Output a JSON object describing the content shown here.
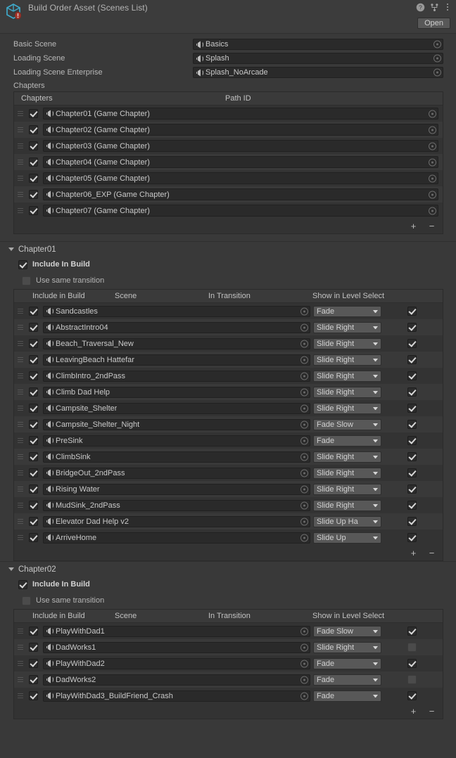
{
  "header": {
    "title": "Build Order Asset (Scenes List)",
    "asset_icon": "scriptable-object-cube-icon",
    "help_icon": "help-icon",
    "preset_icon": "preset-icon",
    "menu_icon": "kebab-menu-icon",
    "open_label": "Open"
  },
  "properties": [
    {
      "label": "Basic Scene",
      "value": "Basics"
    },
    {
      "label": "Loading Scene",
      "value": "Splash"
    },
    {
      "label": "Loading Scene Enterprise",
      "value": "Splash_NoArcade"
    }
  ],
  "chapters_section": {
    "label": "Chapters",
    "columns": {
      "chapters": "Chapters",
      "path_id": "Path ID"
    },
    "rows": [
      {
        "include": true,
        "name": "Chapter01 (Game Chapter)"
      },
      {
        "include": true,
        "name": "Chapter02 (Game Chapter)"
      },
      {
        "include": true,
        "name": "Chapter03 (Game Chapter)"
      },
      {
        "include": true,
        "name": "Chapter04 (Game Chapter)"
      },
      {
        "include": true,
        "name": "Chapter05 (Game Chapter)"
      },
      {
        "include": true,
        "name": "Chapter06_EXP (Game Chapter)"
      },
      {
        "include": true,
        "name": "Chapter07 (Game Chapter)"
      }
    ],
    "add_label": "+",
    "remove_label": "−"
  },
  "columns": {
    "include_in_build": "Include in Build",
    "scene": "Scene",
    "in_transition": "In Transition",
    "show_in_level_select": "Show in Level Select"
  },
  "chapter_sections": [
    {
      "name": "Chapter01",
      "include_in_build_label": "Include In Build",
      "include_in_build": true,
      "use_same_transition_label": "Use same transition",
      "use_same_transition": false,
      "scenes": [
        {
          "include": true,
          "scene": "Sandcastles",
          "transition": "Fade",
          "show": true
        },
        {
          "include": true,
          "scene": "AbstractIntro04",
          "transition": "Slide Right",
          "show": true
        },
        {
          "include": true,
          "scene": "Beach_Traversal_New",
          "transition": "Slide Right",
          "show": true
        },
        {
          "include": true,
          "scene": "LeavingBeach Hattefar",
          "transition": "Slide Right",
          "show": true
        },
        {
          "include": true,
          "scene": "ClimbIntro_2ndPass",
          "transition": "Slide Right",
          "show": true
        },
        {
          "include": true,
          "scene": "Climb Dad Help",
          "transition": "Slide Right",
          "show": true
        },
        {
          "include": true,
          "scene": "Campsite_Shelter",
          "transition": "Slide Right",
          "show": true
        },
        {
          "include": true,
          "scene": "Campsite_Shelter_Night",
          "transition": "Fade Slow",
          "show": true
        },
        {
          "include": true,
          "scene": "PreSink",
          "transition": "Fade",
          "show": true
        },
        {
          "include": true,
          "scene": "ClimbSink",
          "transition": "Slide Right",
          "show": true
        },
        {
          "include": true,
          "scene": "BridgeOut_2ndPass",
          "transition": "Slide Right",
          "show": true
        },
        {
          "include": true,
          "scene": "Rising Water",
          "transition": "Slide Right",
          "show": true
        },
        {
          "include": true,
          "scene": "MudSink_2ndPass",
          "transition": "Slide Right",
          "show": true
        },
        {
          "include": true,
          "scene": "Elevator Dad Help v2",
          "transition": "Slide Up Ha",
          "show": true
        },
        {
          "include": true,
          "scene": "ArriveHome",
          "transition": "Slide Up",
          "show": true
        }
      ]
    },
    {
      "name": "Chapter02",
      "include_in_build_label": "Include In Build",
      "include_in_build": true,
      "use_same_transition_label": "Use same transition",
      "use_same_transition": false,
      "scenes": [
        {
          "include": true,
          "scene": "PlayWithDad1",
          "transition": "Fade Slow",
          "show": true
        },
        {
          "include": true,
          "scene": "DadWorks1",
          "transition": "Slide Right",
          "show": false
        },
        {
          "include": true,
          "scene": "PlayWithDad2",
          "transition": "Fade",
          "show": true
        },
        {
          "include": true,
          "scene": "DadWorks2",
          "transition": "Fade",
          "show": false
        },
        {
          "include": true,
          "scene": "PlayWithDad3_BuildFriend_Crash",
          "transition": "Fade",
          "show": true
        }
      ]
    }
  ],
  "footer": {
    "add_label": "+",
    "remove_label": "−"
  },
  "colors": {
    "panel_bg": "#393939",
    "header_bg": "#3c3c3c",
    "field_bg": "#2a2a2a",
    "dropdown_bg": "#585858",
    "text": "#c4c4c4",
    "asset_icon_cyan": "#3fa9c9",
    "asset_icon_red": "#c0392b"
  }
}
